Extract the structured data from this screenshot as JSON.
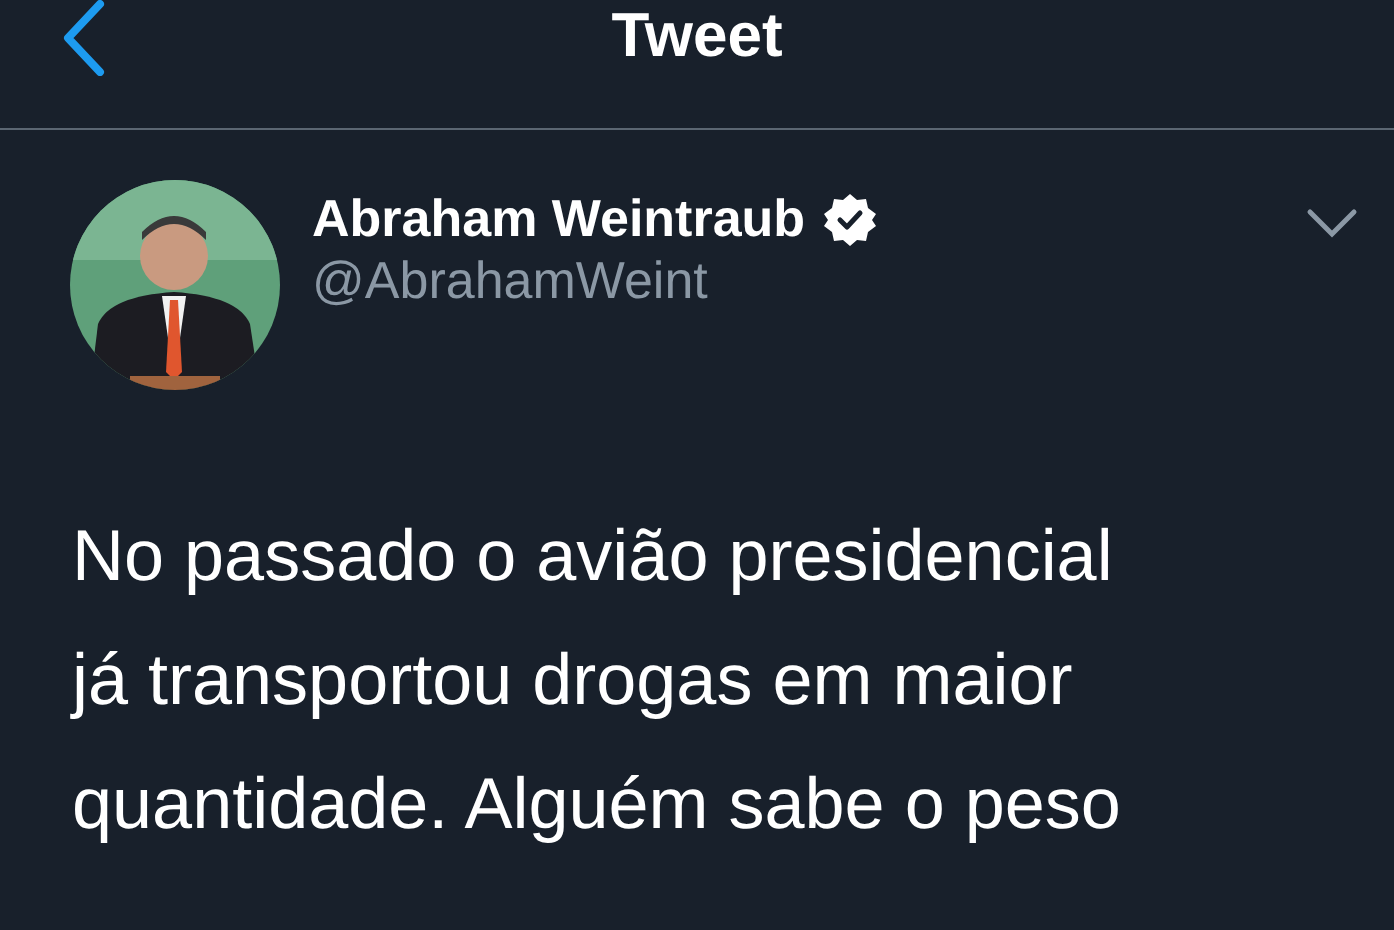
{
  "header": {
    "title": "Tweet"
  },
  "author": {
    "name": "Abraham Weintraub",
    "verified": true,
    "handle": "@AbrahamWeint"
  },
  "tweet": {
    "text": "No passado o avião presidencial já transportou drogas em maior quantidade. Alguém sabe o peso"
  }
}
